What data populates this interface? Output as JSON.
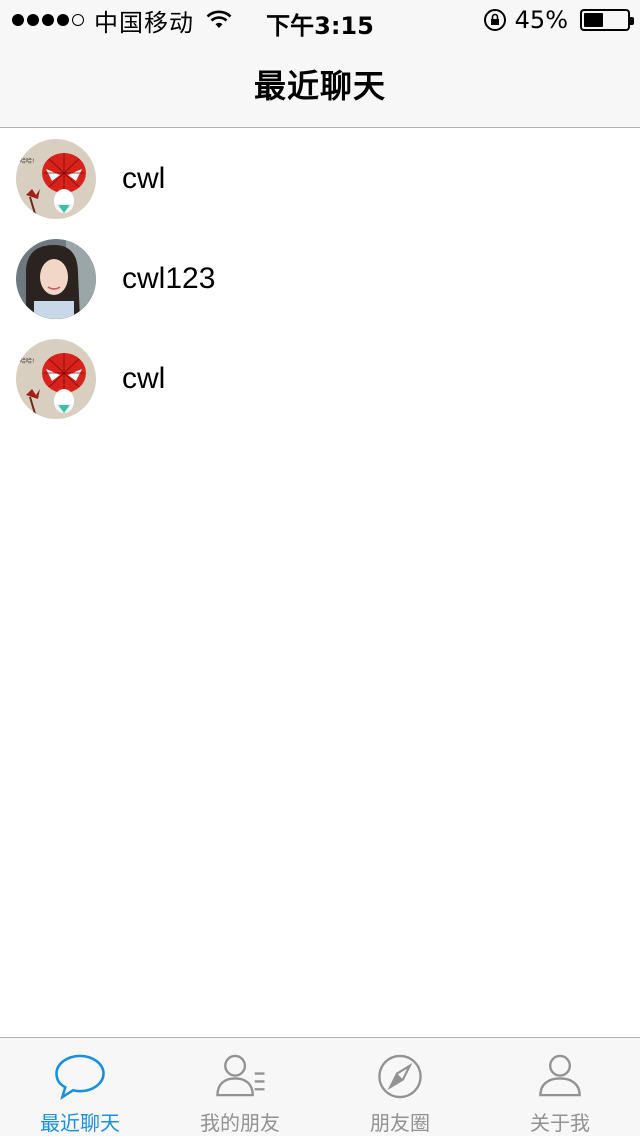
{
  "status_bar": {
    "carrier": "中国移动",
    "time": "下午3:15",
    "battery_percent": "45%",
    "battery_level": 0.45
  },
  "nav": {
    "title": "最近聊天"
  },
  "chats": [
    {
      "name": "cwl",
      "avatar": "spiderman-avatar"
    },
    {
      "name": "cwl123",
      "avatar": "girl-photo-avatar"
    },
    {
      "name": "cwl",
      "avatar": "spiderman-avatar"
    }
  ],
  "tab_bar": {
    "tabs": [
      {
        "label": "最近聊天",
        "icon": "chat-bubble-icon",
        "active": true
      },
      {
        "label": "我的朋友",
        "icon": "friends-list-icon",
        "active": false
      },
      {
        "label": "朋友圈",
        "icon": "compass-icon",
        "active": false
      },
      {
        "label": "关于我",
        "icon": "person-icon",
        "active": false
      }
    ]
  },
  "colors": {
    "accent": "#1a8fe0",
    "inactive": "#929292",
    "bar_background": "#f7f7f7"
  }
}
